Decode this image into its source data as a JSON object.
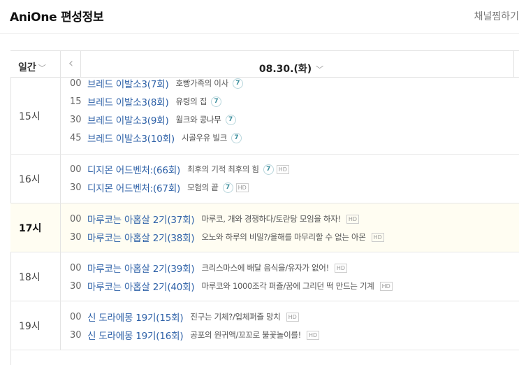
{
  "header": {
    "title": "AniOne 편성정보",
    "favorite_label": "채널찜하기"
  },
  "schedule_header": {
    "period": "일간",
    "date": "08.30.(화)"
  },
  "icons": {
    "period_chevron": "chevron-down-icon",
    "prev": "chevron-left-icon",
    "date_chevron": "chevron-down-icon"
  },
  "rows": [
    {
      "hour": "15시",
      "current": false,
      "programs": [
        {
          "min": "00",
          "title": "브레드 이발소3(7회)",
          "sub": "호빵가족의 이사",
          "age": "7",
          "hd": ""
        },
        {
          "min": "15",
          "title": "브레드 이발소3(8회)",
          "sub": "유령의 집",
          "age": "7",
          "hd": ""
        },
        {
          "min": "30",
          "title": "브레드 이발소3(9회)",
          "sub": "윌크와 콩나무",
          "age": "7",
          "hd": ""
        },
        {
          "min": "45",
          "title": "브레드 이발소3(10회)",
          "sub": "시골우유 빌크",
          "age": "7",
          "hd": ""
        }
      ]
    },
    {
      "hour": "16시",
      "current": false,
      "programs": [
        {
          "min": "00",
          "title": "디지몬 어드벤처:(66회)",
          "sub": "최후의 기적 최후의 힘",
          "age": "7",
          "hd": "HD"
        },
        {
          "min": "30",
          "title": "디지몬 어드벤처:(67회)",
          "sub": "모험의 끝",
          "age": "7",
          "hd": "HD"
        }
      ]
    },
    {
      "hour": "17시",
      "current": true,
      "programs": [
        {
          "min": "00",
          "title": "마루코는 아홉살 2기(37회)",
          "sub": "마루코, 개와 경쟁하다/토란탕 모임을 하자!",
          "age": "",
          "hd": "HD"
        },
        {
          "min": "30",
          "title": "마루코는 아홉살 2기(38회)",
          "sub": "오노와 하루의 비밀?/올해를 마무리할 수 없는 아몬",
          "age": "",
          "hd": "HD"
        }
      ]
    },
    {
      "hour": "18시",
      "current": false,
      "programs": [
        {
          "min": "00",
          "title": "마루코는 아홉살 2기(39회)",
          "sub": "크리스마스에 배달 음식을/유자가 없어!",
          "age": "",
          "hd": "HD"
        },
        {
          "min": "30",
          "title": "마루코는 아홉살 2기(40회)",
          "sub": "마루코와 1000조각 퍼즐/꿈에 그리던 떡 만드는 기계",
          "age": "",
          "hd": "HD"
        }
      ]
    },
    {
      "hour": "19시",
      "current": false,
      "programs": [
        {
          "min": "00",
          "title": "신 도라에몽 19기(15회)",
          "sub": "진구는 기체?/입체퍼즐 망치",
          "age": "",
          "hd": "HD"
        },
        {
          "min": "30",
          "title": "신 도라에몽 19기(16회)",
          "sub": "공포의 원귀액/꼬꼬로 불꽃놀이를!",
          "age": "",
          "hd": "HD"
        }
      ]
    }
  ]
}
